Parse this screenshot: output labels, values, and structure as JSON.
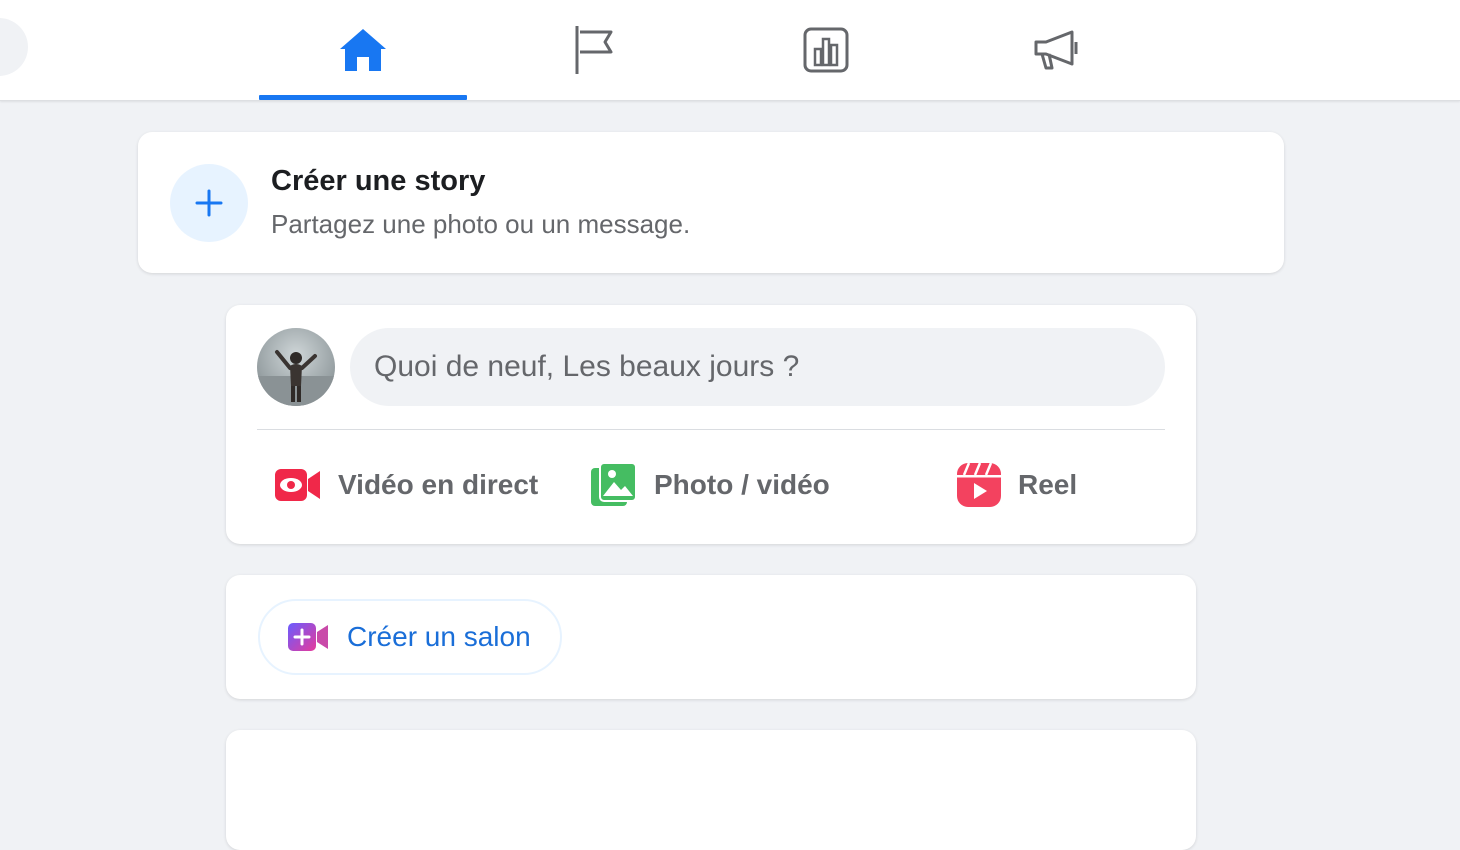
{
  "nav": {
    "tabs": [
      {
        "name": "home",
        "icon": "home-icon",
        "active": true
      },
      {
        "name": "pages",
        "icon": "flag-icon",
        "active": false
      },
      {
        "name": "insights",
        "icon": "bar-chart-icon",
        "active": false
      },
      {
        "name": "ads",
        "icon": "megaphone-icon",
        "active": false
      }
    ],
    "accent_color": "#1877f2"
  },
  "story": {
    "title": "Créer une story",
    "subtitle": "Partagez une photo ou un message."
  },
  "composer": {
    "placeholder": "Quoi de neuf, Les beaux jours ?",
    "actions": [
      {
        "label": "Vidéo en direct",
        "icon": "live-video-icon",
        "color": "#f02849"
      },
      {
        "label": "Photo / vidéo",
        "icon": "photo-video-icon",
        "color": "#45bd62"
      },
      {
        "label": "Reel",
        "icon": "reel-icon",
        "color": "#f3425f"
      }
    ]
  },
  "room": {
    "button_label": "Créer un salon",
    "icon": "create-room-icon"
  }
}
